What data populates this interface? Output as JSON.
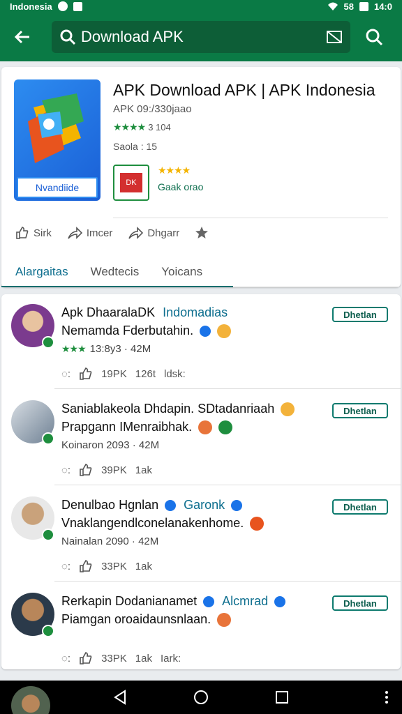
{
  "status_bar": {
    "left_text": "Indonesia",
    "battery": "58",
    "time": "14:0"
  },
  "search": {
    "query": "Download APK"
  },
  "app": {
    "title": "APK Download APK | APK Indonesia",
    "subtitle": "APK 09:/330jaao",
    "rating_value": "3 104",
    "size": "Saola : 15",
    "icon_label": "Nvandiide",
    "developer_logo_text": "DK",
    "developer_name": "Gaak orao"
  },
  "actions": [
    {
      "label": "Sirk",
      "icon": "like-icon"
    },
    {
      "label": "Imcer",
      "icon": "share-icon"
    },
    {
      "label": "Dhgarr",
      "icon": "share-icon"
    },
    {
      "label": "",
      "icon": "star-icon"
    }
  ],
  "tabs": [
    {
      "label": "Alargaitas",
      "active": true
    },
    {
      "label": "Wedtecis",
      "active": false
    },
    {
      "label": "Yoicans",
      "active": false
    }
  ],
  "posts": [
    {
      "name": "Apk DhaaralaDK",
      "tag": "Indomadias",
      "text": "Nemamda Fderbutahin.",
      "meta": "13:8y3 · 42M",
      "likes": "19PK",
      "shares": "126t",
      "extra": "ldsk:",
      "follow": "Dhetlan",
      "avatar_color": "#7b3b8e"
    },
    {
      "name": "Saniablakeola Dhdapin. SDtadanriaah",
      "tag": "",
      "text": "Prapgann IMenraibhak.",
      "meta": "Koinaron 2093 · 42M",
      "likes": "39PK",
      "shares": "1ak",
      "extra": "",
      "follow": "Dhetlan",
      "avatar_color": "#9aa5b1"
    },
    {
      "name": "Denulbao Hgnlan",
      "tag": "Garonk",
      "text": "Vnaklangendlconelanakenhome.",
      "meta": "Nainalan 2090 · 42M",
      "likes": "33PK",
      "shares": "1ak",
      "extra": "",
      "follow": "Dhetlan",
      "avatar_color": "#c9a27b"
    },
    {
      "name": "Rerkapin Dodanianamet",
      "tag": "Alcmrad",
      "text": "Piamgan oroaidaunsnlaan.",
      "meta": "",
      "likes": "33PK",
      "shares": "1ak",
      "extra": "Iark:",
      "follow": "Dhetlan",
      "avatar_color": "#b8865a"
    }
  ],
  "colors": {
    "brand": "#0a7a45",
    "accent": "#0d6e8e",
    "star": "#1e8e3e",
    "star_gold": "#f4b400"
  }
}
